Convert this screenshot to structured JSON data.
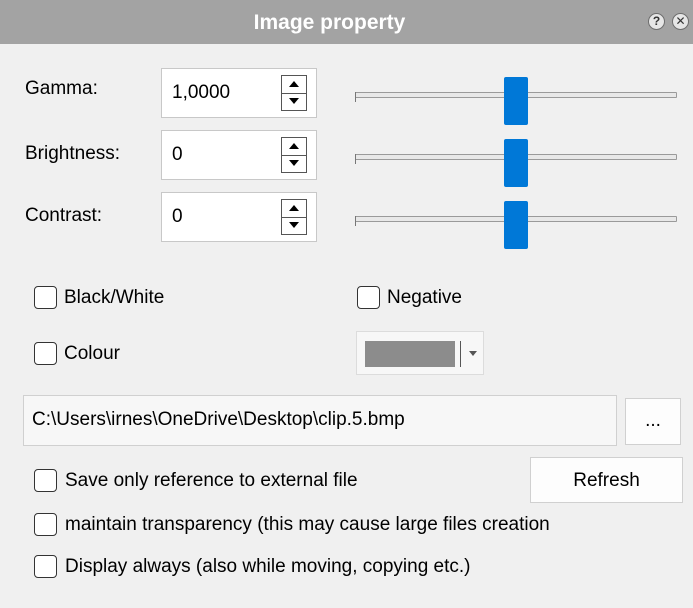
{
  "window": {
    "title": "Image property",
    "help_icon": "question-icon",
    "close_icon": "close-icon"
  },
  "adjustments": {
    "gamma": {
      "label": "Gamma:",
      "value": "1,0000",
      "slider_fraction": 0.5
    },
    "brightness": {
      "label": "Brightness:",
      "value": "0",
      "slider_fraction": 0.5
    },
    "contrast": {
      "label": "Contrast:",
      "value": "0",
      "slider_fraction": 0.5
    }
  },
  "options": {
    "black_white": {
      "label": "Black/White",
      "checked": false
    },
    "negative": {
      "label": "Negative",
      "checked": false
    },
    "colour": {
      "label": "Colour",
      "checked": false,
      "color": "#8c8c8c"
    }
  },
  "file": {
    "path": "C:\\Users\\irnes\\OneDrive\\Desktop\\clip.5.bmp",
    "browse_label": "...",
    "refresh_label": "Refresh"
  },
  "settings": {
    "save_reference": {
      "label": "Save only reference to external file",
      "checked": false
    },
    "maintain_transparency": {
      "label": "maintain transparency (this may cause large files creation",
      "checked": false
    },
    "display_always": {
      "label": "Display always (also while moving, copying etc.)",
      "checked": false
    }
  },
  "colors": {
    "accent": "#0078d7",
    "titlebar": "#a3a3a3"
  }
}
